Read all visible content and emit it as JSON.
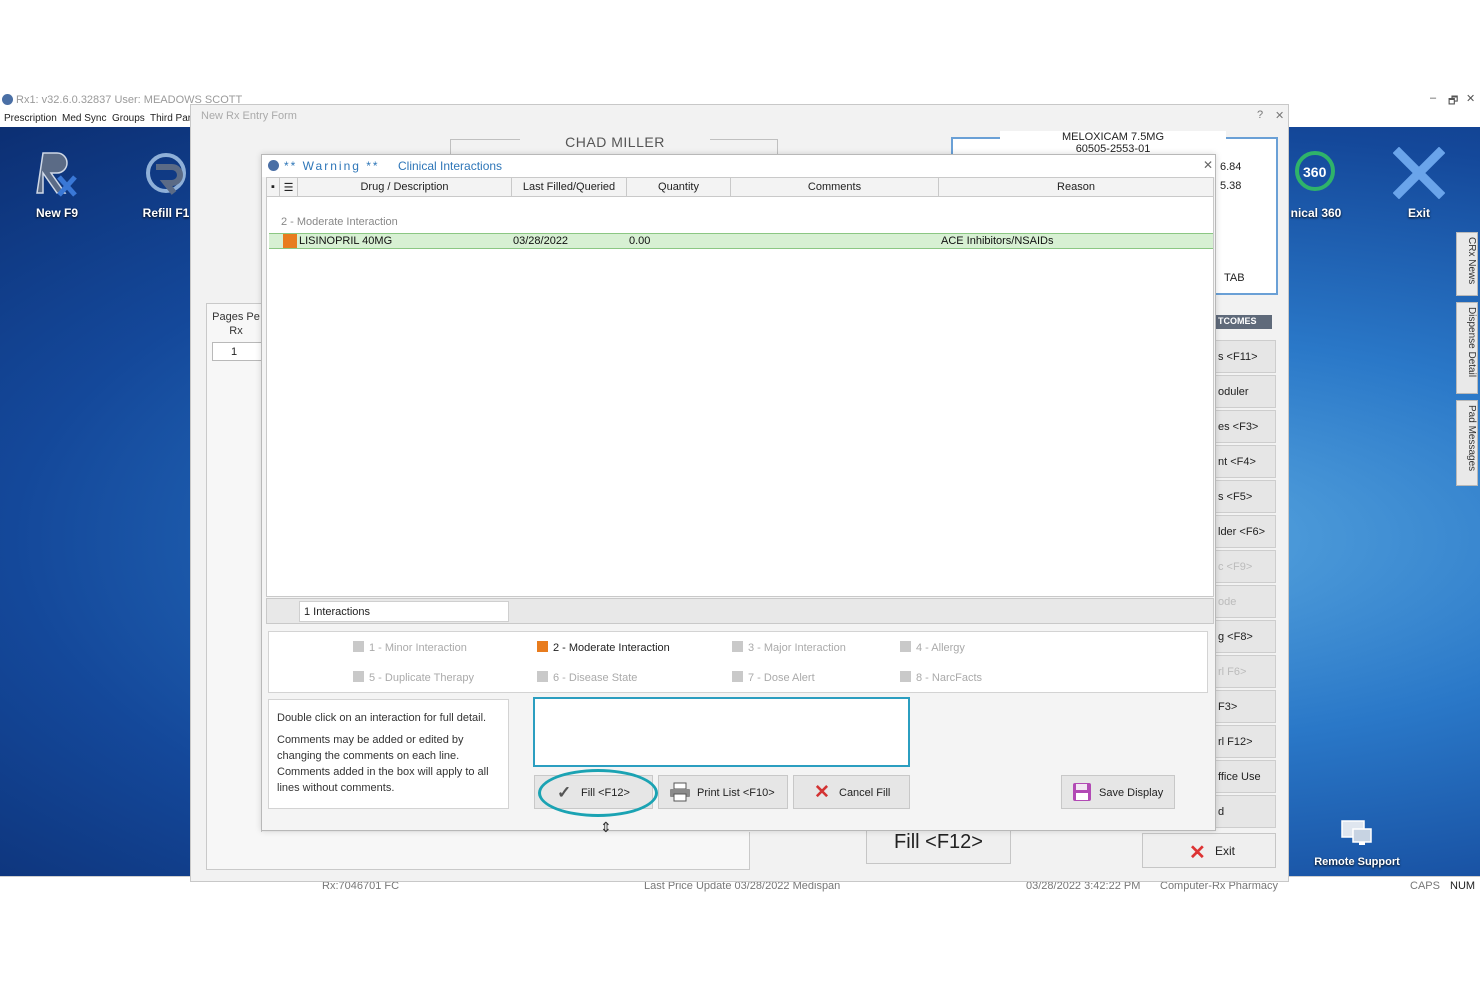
{
  "app": {
    "title": "Rx1: v32.6.0.32837  User: MEADOWS SCOTT",
    "window_controls": [
      "–",
      "🗗",
      "✕"
    ],
    "menu": [
      "Prescription",
      "Med Sync",
      "Groups",
      "Third Part"
    ]
  },
  "toolbar": {
    "new_label": "New F9",
    "refill_label": "Refill F1",
    "clinical_label": "nical 360",
    "exit_label": "Exit",
    "remote_label": "Remote Support"
  },
  "right_tabs": [
    "CRx News",
    "Dispense Detail",
    "Pad Messages"
  ],
  "status": {
    "rx": "Rx:7046701 FC",
    "price_update": "Last Price Update 03/28/2022 Medispan",
    "datetime": "03/28/2022 3:42:22 PM",
    "pharmacy": "Computer-Rx Pharmacy",
    "caps": "CAPS",
    "num": "NUM"
  },
  "rxform": {
    "title": "New Rx Entry Form",
    "controls": [
      "?",
      "✕"
    ],
    "patient_name": "CHAD MILLER",
    "drug_line1": "MELOXICAM 7.5MG",
    "drug_line2": "60505-2553-01",
    "price1": "6.84",
    "price2": "5.38",
    "tab_text": "TAB",
    "pages_label": "Pages Pe Rx",
    "pages_value": "1",
    "outcomes_tag": "TCOMES",
    "side_buttons": [
      "s <F11>",
      "oduler",
      "es <F3>",
      "nt <F4>",
      "s <F5>",
      "lder <F6>",
      "c <F9>",
      "ode",
      "g <F8>",
      "rl F6>",
      "F3>",
      "rl F12>",
      "ffice Use",
      "d"
    ],
    "fill_big": "Fill <F12>",
    "exit_big": "Exit"
  },
  "dialog": {
    "title_warning": "** Warning **",
    "title_clinical": "Clinical Interactions",
    "close": "✕",
    "columns": [
      "Drug / Description",
      "Last Filled/Queried",
      "Quantity",
      "Comments",
      "Reason"
    ],
    "group_label": "2 - Moderate Interaction",
    "rows": [
      {
        "drug": "LISINOPRIL  40MG",
        "last_filled": "03/28/2022",
        "quantity": "0.00",
        "comments": "",
        "reason": "ACE Inhibitors/NSAIDs",
        "severity_color": "#e87c1e"
      }
    ],
    "count_text": "1 Interactions",
    "legend": [
      {
        "label": "1 - Minor Interaction",
        "active": false
      },
      {
        "label": "2 - Moderate Interaction",
        "active": true
      },
      {
        "label": "3 - Major Interaction",
        "active": false
      },
      {
        "label": "4 - Allergy",
        "active": false
      },
      {
        "label": "5 - Duplicate Therapy",
        "active": false
      },
      {
        "label": "6 - Disease State",
        "active": false
      },
      {
        "label": "7 - Dose Alert",
        "active": false
      },
      {
        "label": "8 - NarcFacts",
        "active": false
      }
    ],
    "help_line1": "Double click on an interaction for full detail.",
    "help_line2": "Comments may be added or edited by changing the comments on each line. Comments added in the box will apply to all lines without comments.",
    "comment_value": "",
    "buttons": {
      "fill": "Fill <F12>",
      "print": "Print List <F10>",
      "cancel": "Cancel Fill",
      "save": "Save Display"
    }
  },
  "colors": {
    "accent": "#2e76b8",
    "moderate": "#e87c1e",
    "row_highlight": "#d7f0d3",
    "focus_ring": "#1ba3b3",
    "cancel_x": "#d33333"
  }
}
